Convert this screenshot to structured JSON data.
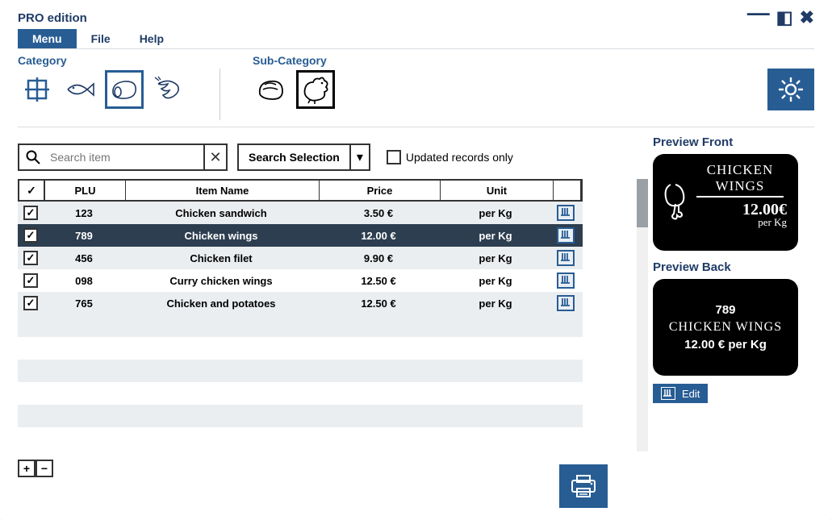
{
  "window": {
    "title": "PRO edition"
  },
  "menubar": {
    "items": [
      "Menu",
      "File",
      "Help"
    ],
    "active": 0
  },
  "category": {
    "label": "Category"
  },
  "subcategory": {
    "label": "Sub-Category"
  },
  "search": {
    "placeholder": "Search item",
    "selection_label": "Search Selection",
    "updated_label": "Updated records only"
  },
  "table": {
    "headers": {
      "plu": "PLU",
      "name": "Item Name",
      "price": "Price",
      "unit": "Unit"
    },
    "rows": [
      {
        "plu": "123",
        "name": "Chicken sandwich",
        "price": "3.50 €",
        "unit": "per Kg",
        "checked": true,
        "selected": false
      },
      {
        "plu": "789",
        "name": "Chicken wings",
        "price": "12.00 €",
        "unit": "per Kg",
        "checked": true,
        "selected": true
      },
      {
        "plu": "456",
        "name": "Chicken filet",
        "price": "9.90 €",
        "unit": "per Kg",
        "checked": true,
        "selected": false
      },
      {
        "plu": "098",
        "name": "Curry chicken wings",
        "price": "12.50 €",
        "unit": "per Kg",
        "checked": true,
        "selected": false
      },
      {
        "plu": "765",
        "name": "Chicken and potatoes",
        "price": "12.50 €",
        "unit": "per Kg",
        "checked": true,
        "selected": false
      }
    ]
  },
  "preview": {
    "front_label": "Preview Front",
    "back_label": "Preview Back",
    "front": {
      "line1": "CHICKEN",
      "line2": "WINGS",
      "price": "12.00€",
      "unit": "per Kg"
    },
    "back": {
      "plu": "789",
      "name": "CHICKEN WINGS",
      "priceunit": "12.00 € per Kg"
    },
    "edit_label": "Edit"
  }
}
